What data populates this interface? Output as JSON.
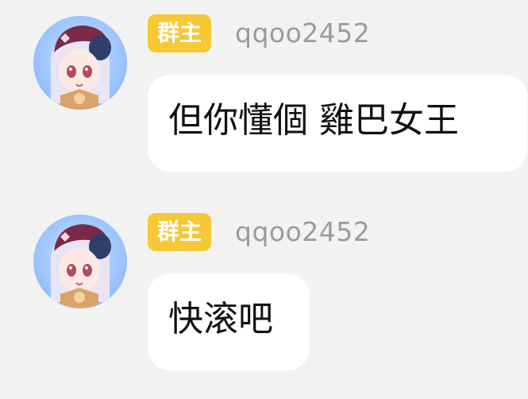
{
  "messages": [
    {
      "badge": "群主",
      "username": "qqoo2452",
      "text": "但你懂個 雞巴女王"
    },
    {
      "badge": "群主",
      "username": "qqoo2452",
      "text": "快滚吧"
    }
  ],
  "colors": {
    "background": "#f2f2f2",
    "badge": "#f6c836",
    "username": "#9b9b9b",
    "bubble": "#ffffff"
  }
}
